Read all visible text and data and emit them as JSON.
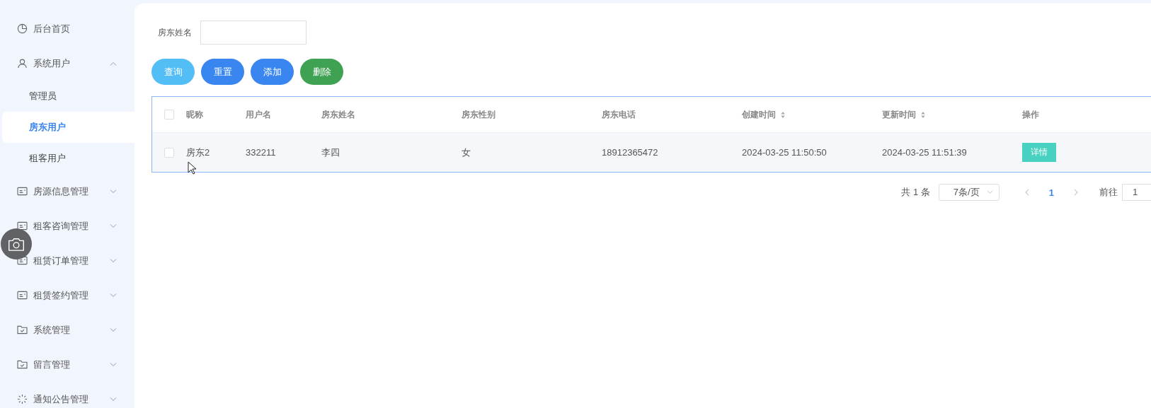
{
  "sidebar": {
    "items": [
      {
        "kind": "link",
        "label": "后台首页"
      },
      {
        "kind": "group",
        "label": "系统用户",
        "expanded": true,
        "children": [
          {
            "label": "管理员",
            "selected": false
          },
          {
            "label": "房东用户",
            "selected": true
          },
          {
            "label": "租客用户",
            "selected": false
          }
        ]
      },
      {
        "kind": "group",
        "label": "房源信息管理",
        "expanded": false
      },
      {
        "kind": "group",
        "label": "租客咨询管理",
        "expanded": false
      },
      {
        "kind": "group",
        "label": "租赁订单管理",
        "expanded": false
      },
      {
        "kind": "group",
        "label": "租赁签约管理",
        "expanded": false
      },
      {
        "kind": "group",
        "label": "系统管理",
        "expanded": false
      },
      {
        "kind": "group",
        "label": "留言管理",
        "expanded": false
      },
      {
        "kind": "group",
        "label": "通知公告管理",
        "expanded": false
      }
    ]
  },
  "search": {
    "label": "房东姓名"
  },
  "buttons": [
    {
      "kind": "query",
      "label": "查询"
    },
    {
      "kind": "reset",
      "label": "重置"
    },
    {
      "kind": "add",
      "label": "添加"
    },
    {
      "kind": "delete",
      "label": "删除"
    }
  ],
  "table": {
    "select_all": {
      "checked": false
    },
    "columns": [
      {
        "label": "昵称",
        "sortable": false
      },
      {
        "label": "用户名",
        "sortable": false
      },
      {
        "label": "房东姓名",
        "sortable": false
      },
      {
        "label": "房东性别",
        "sortable": false
      },
      {
        "label": "房东电话",
        "sortable": false
      },
      {
        "label": "创建时间",
        "sortable": true
      },
      {
        "label": "更新时间",
        "sortable": true
      },
      {
        "label": "操作",
        "sortable": false
      }
    ],
    "rows": [
      {
        "checked": false,
        "cells": [
          "房东2",
          "332211",
          "李四",
          "女",
          "18912365472",
          "2024-03-25 11:50:50",
          "2024-03-25 11:51:39"
        ],
        "action": "详情"
      }
    ]
  },
  "pagination": {
    "total": "共 1 条",
    "page_size": "7条/页",
    "pages": [
      {
        "label": "1",
        "selected": true
      }
    ],
    "goto_label": "前往",
    "goto_value": "1"
  }
}
